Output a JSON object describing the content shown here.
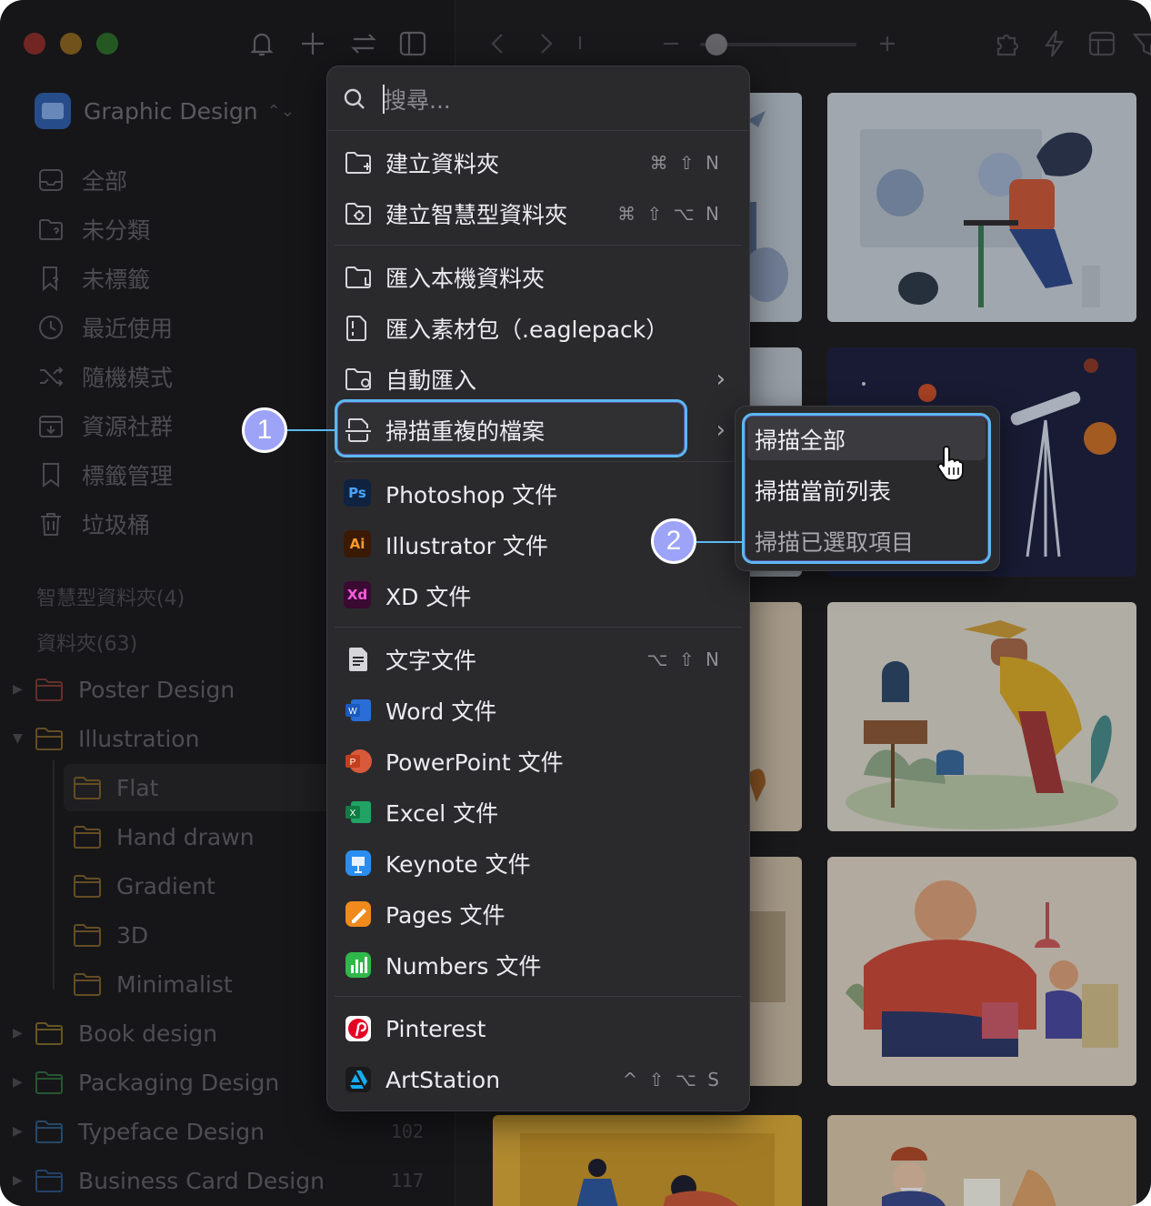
{
  "library": {
    "name": "Graphic Design"
  },
  "nav": [
    {
      "label": "全部",
      "icon": "inbox-icon"
    },
    {
      "label": "未分類",
      "icon": "folder-question-icon"
    },
    {
      "label": "未標籤",
      "icon": "tag-question-icon"
    },
    {
      "label": "最近使用",
      "icon": "clock-icon"
    },
    {
      "label": "隨機模式",
      "icon": "shuffle-icon"
    },
    {
      "label": "資源社群",
      "icon": "community-icon"
    },
    {
      "label": "標籤管理",
      "icon": "bookmark-icon"
    },
    {
      "label": "垃圾桶",
      "icon": "trash-icon"
    }
  ],
  "sections": {
    "smart_folders": "智慧型資料夾(4)",
    "folders": "資料夾(63)"
  },
  "folders": [
    {
      "label": "Poster Design",
      "color": "#d0453a",
      "expanded": false
    },
    {
      "label": "Illustration",
      "color": "#d6a13a",
      "expanded": true
    },
    {
      "label": "Flat",
      "color": "#d6a13a",
      "child": true
    },
    {
      "label": "Hand drawn",
      "color": "#d6a13a",
      "child": true
    },
    {
      "label": "Gradient",
      "color": "#d6a13a",
      "child": true
    },
    {
      "label": "3D",
      "color": "#d6a13a",
      "child": true
    },
    {
      "label": "Minimalist",
      "color": "#d6a13a",
      "child": true
    },
    {
      "label": "Book design",
      "color": "#d6b23a",
      "expanded": false
    },
    {
      "label": "Packaging Design",
      "color": "#3aa65a",
      "expanded": false
    },
    {
      "label": "Typeface Design",
      "color": "#3a8fd6",
      "expanded": false,
      "count": "102"
    },
    {
      "label": "Business Card Design",
      "color": "#3a7fd6",
      "expanded": false,
      "count": "117"
    }
  ],
  "menu": {
    "search_placeholder": "搜尋...",
    "items": [
      {
        "label": "建立資料夾",
        "shortcut": "⌘ ⇧ N",
        "icon": "folder-add-icon"
      },
      {
        "label": "建立智慧型資料夾",
        "shortcut": "⌘ ⇧ ⌥ N",
        "icon": "smart-folder-icon"
      },
      {
        "label": "匯入本機資料夾",
        "icon": "folder-import-icon"
      },
      {
        "label": "匯入素材包（.eaglepack）",
        "icon": "package-import-icon"
      },
      {
        "label": "自動匯入",
        "icon": "auto-import-icon",
        "submenu": true
      },
      {
        "label": "掃描重複的檔案",
        "icon": "scan-duplicate-icon",
        "submenu": true
      },
      {
        "label": "Photoshop 文件",
        "badge": "Ps",
        "badge_bg": "#0f2340",
        "badge_fg": "#4aa3ff"
      },
      {
        "label": "Illustrator 文件",
        "badge": "Ai",
        "badge_bg": "#3a1a05",
        "badge_fg": "#ff9a2e"
      },
      {
        "label": "XD 文件",
        "badge": "Xd",
        "badge_bg": "#3a0a33",
        "badge_fg": "#ff5ce1"
      },
      {
        "label": "文字文件",
        "shortcut": "⌥ ⇧ N",
        "icon": "text-file-icon"
      },
      {
        "label": "Word 文件",
        "icon": "word-icon"
      },
      {
        "label": "PowerPoint 文件",
        "icon": "powerpoint-icon"
      },
      {
        "label": "Excel 文件",
        "icon": "excel-icon"
      },
      {
        "label": "Keynote 文件",
        "icon": "keynote-icon"
      },
      {
        "label": "Pages 文件",
        "icon": "pages-icon"
      },
      {
        "label": "Numbers 文件",
        "icon": "numbers-icon"
      },
      {
        "label": "Pinterest",
        "icon": "pinterest-icon"
      },
      {
        "label": "ArtStation",
        "shortcut": "^ ⇧ ⌥ S",
        "icon": "artstation-icon"
      }
    ]
  },
  "submenu": {
    "items": [
      {
        "label": "掃描全部"
      },
      {
        "label": "掃描當前列表"
      },
      {
        "label": "掃描已選取項目"
      }
    ]
  },
  "callouts": [
    "1",
    "2"
  ],
  "colors": {
    "highlight": "#5cb8f0",
    "callout": "#9da3f7"
  }
}
